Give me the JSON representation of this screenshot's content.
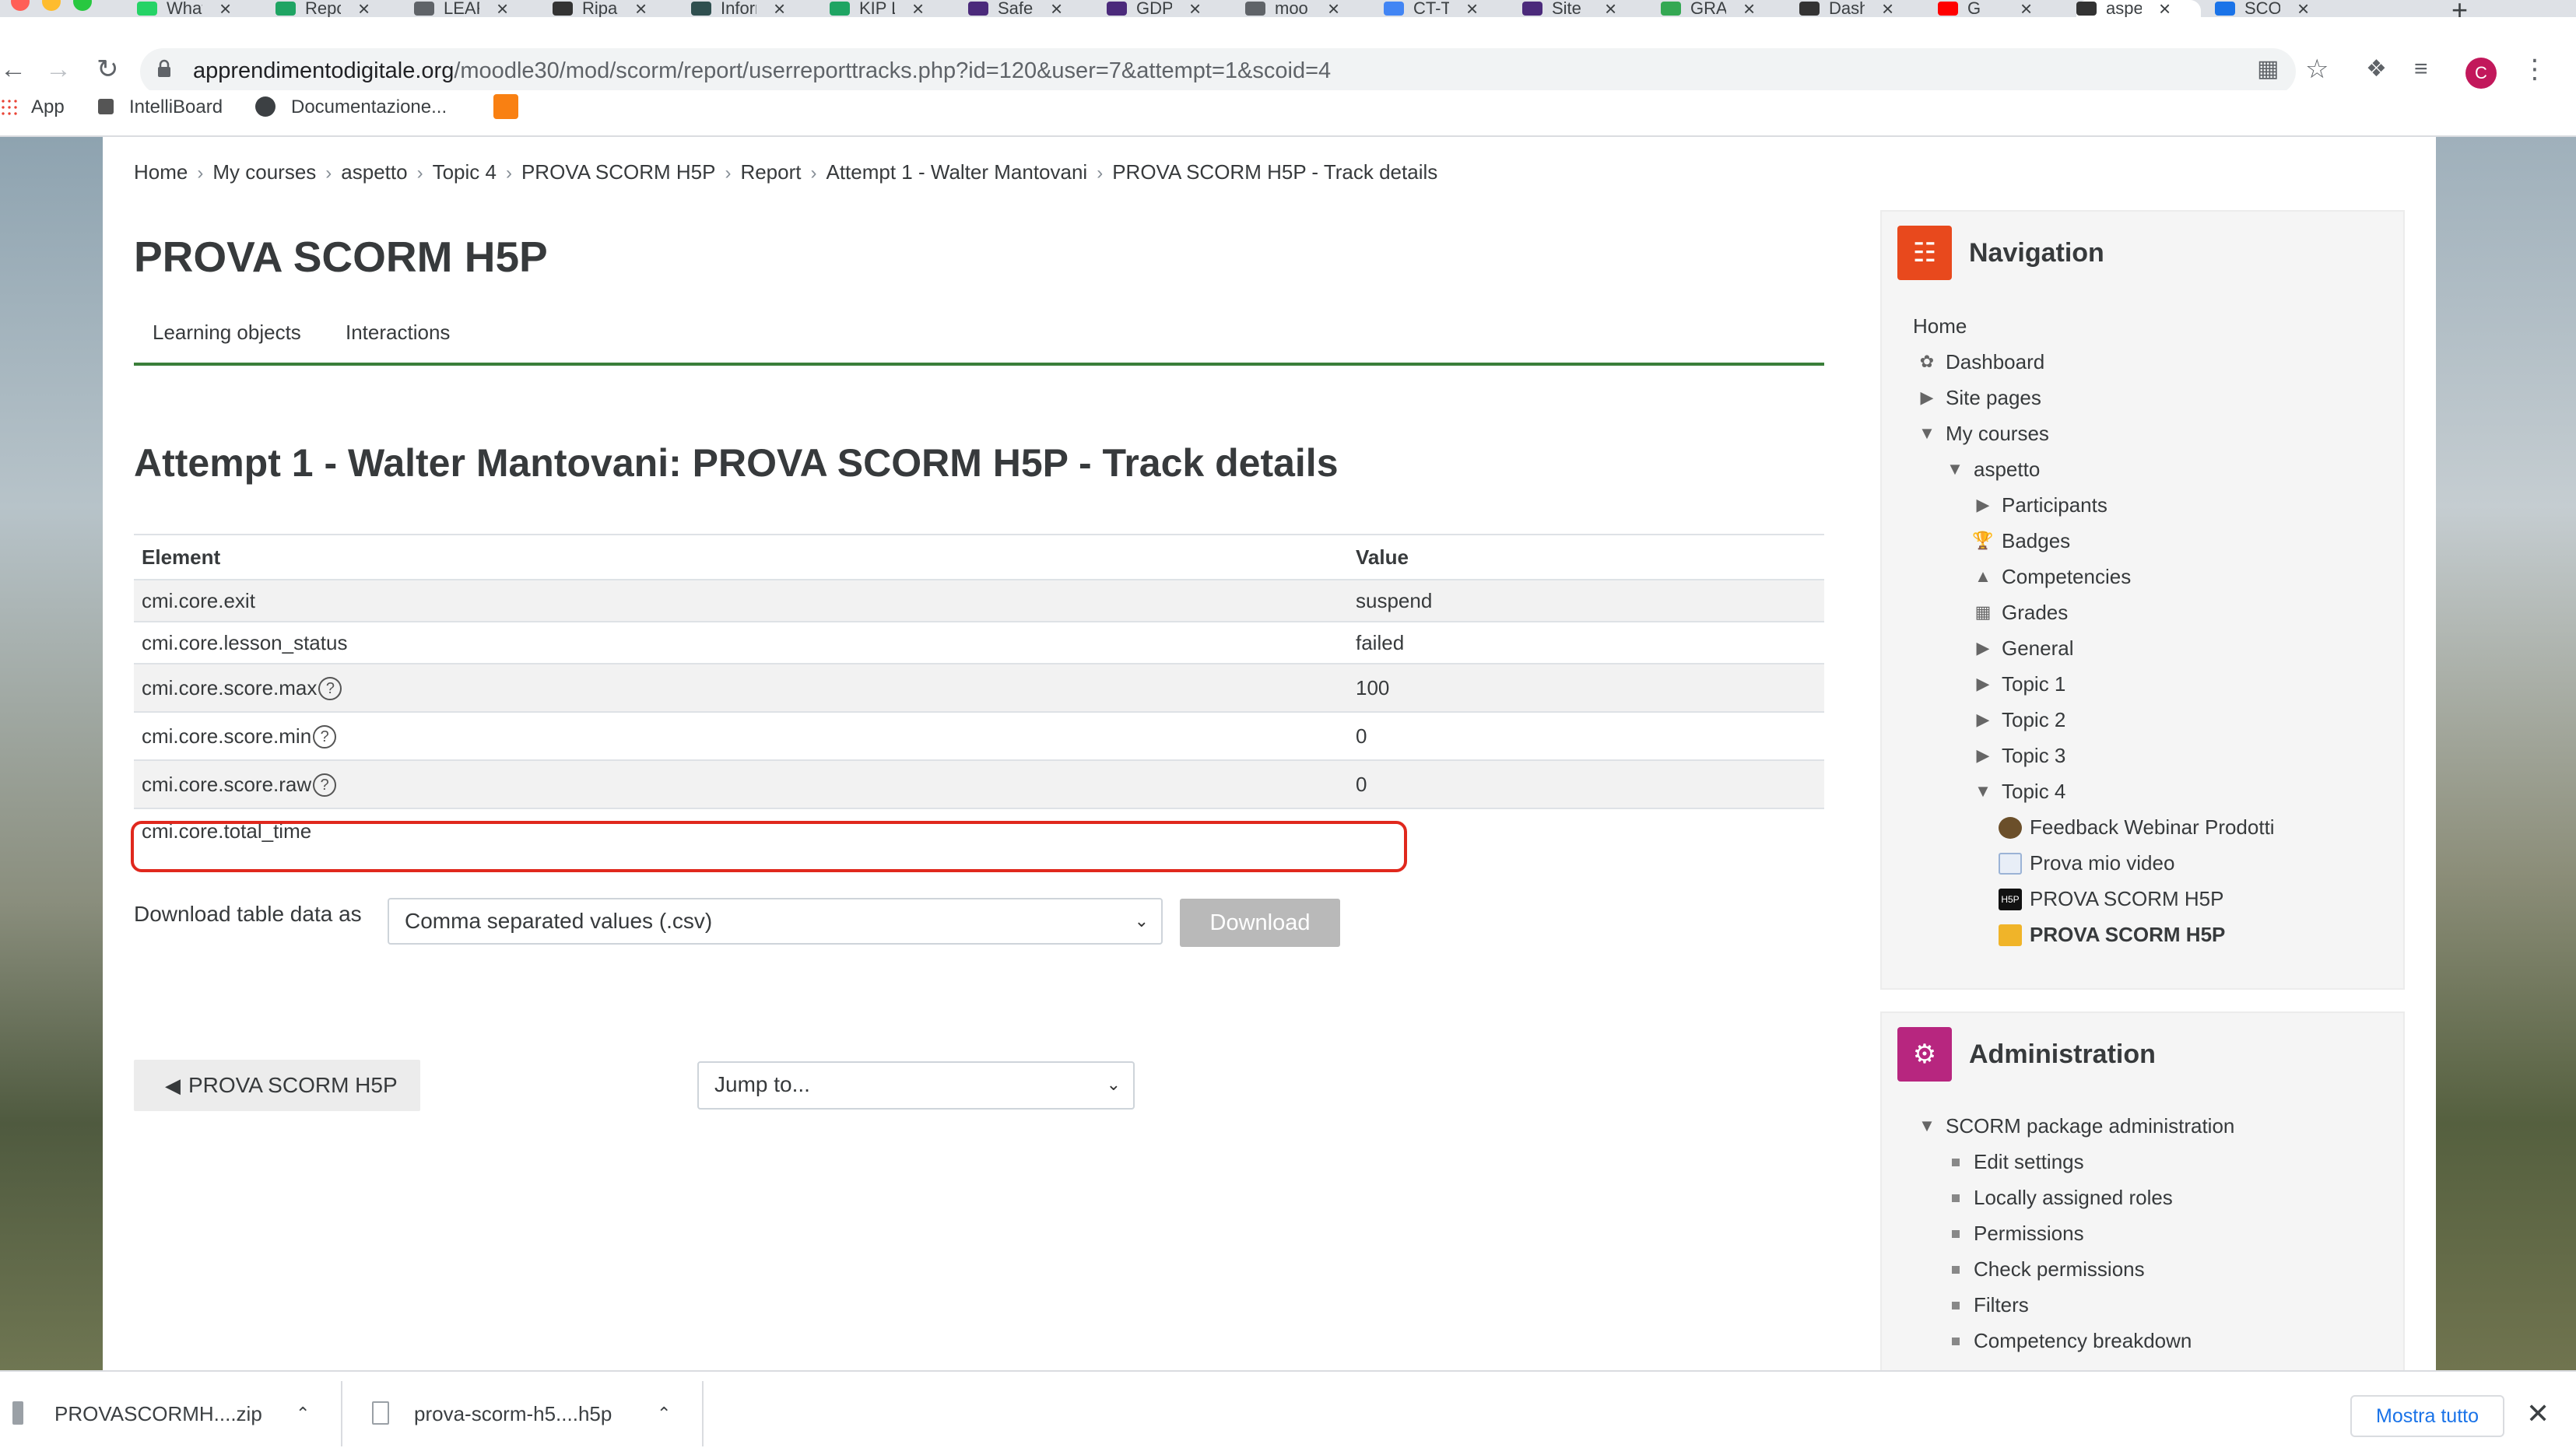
{
  "browser": {
    "tabs": [
      {
        "label": "What",
        "color": "#25d366"
      },
      {
        "label": "Repo",
        "color": "#1fa463"
      },
      {
        "label": "LEAR",
        "color": "#5f6368"
      },
      {
        "label": "Ripar",
        "color": "#333333"
      },
      {
        "label": "Inforr",
        "color": "#2f4f4f"
      },
      {
        "label": "KIP L",
        "color": "#1fa463"
      },
      {
        "label": "Safe",
        "color": "#4b2a7b"
      },
      {
        "label": "GDPI",
        "color": "#4b2a7b"
      },
      {
        "label": "moo",
        "color": "#5f6368"
      },
      {
        "label": "CT-T",
        "color": "#4285f4"
      },
      {
        "label": "Site",
        "color": "#4b2a7b"
      },
      {
        "label": "GRAI",
        "color": "#34a853"
      },
      {
        "label": "Dash",
        "color": "#333333"
      },
      {
        "label": "G",
        "color": "#ff0000"
      },
      {
        "label": "aspe",
        "color": "#333333"
      },
      {
        "label": "SCOI",
        "color": "#1a73e8"
      }
    ],
    "url_host": "apprendimentodigitale.org",
    "url_path": "/moodle30/mod/scorm/report/userreporttracks.php?id=120&user=7&attempt=1&scoid=4",
    "profile_initial": "C",
    "bookmarks": [
      "App",
      "IntelliBoard",
      "Documentazione..."
    ]
  },
  "breadcrumb": [
    "Home",
    "My courses",
    "aspetto",
    "Topic 4",
    "PROVA SCORM H5P",
    "Report",
    "Attempt 1 - Walter Mantovani",
    "PROVA SCORM H5P - Track details"
  ],
  "course_title": "PROVA SCORM H5P",
  "tabs": [
    "Learning objects",
    "Interactions"
  ],
  "attempt_heading": "Attempt 1 - Walter Mantovani: PROVA SCORM H5P - Track details",
  "table": {
    "headers": [
      "Element",
      "Value"
    ],
    "rows": [
      {
        "element": "cmi.core.exit",
        "value": "suspend",
        "help": false
      },
      {
        "element": "cmi.core.lesson_status",
        "value": "failed",
        "help": false
      },
      {
        "element": "cmi.core.score.max",
        "value": "100",
        "help": true
      },
      {
        "element": "cmi.core.score.min",
        "value": "0",
        "help": true
      },
      {
        "element": "cmi.core.score.raw",
        "value": "0",
        "help": true
      },
      {
        "element": "cmi.core.total_time",
        "value": "",
        "help": false
      }
    ]
  },
  "download": {
    "label": "Download table data as",
    "format": "Comma separated values (.csv)",
    "button": "Download"
  },
  "back_button": "PROVA SCORM H5P",
  "jump_to": "Jump to...",
  "navigation": {
    "title": "Navigation",
    "accent": "#e8491d",
    "items": [
      "Home",
      "Dashboard",
      "Site pages",
      "My courses",
      "aspetto",
      "Participants",
      "Badges",
      "Competencies",
      "Grades",
      "General",
      "Topic 1",
      "Topic 2",
      "Topic 3",
      "Topic 4",
      "Feedback Webinar Prodotti",
      "Prova mio video",
      "PROVA SCORM H5P",
      "PROVA SCORM H5P"
    ]
  },
  "administration": {
    "title": "Administration",
    "accent": "#b7267f",
    "section": "SCORM package administration",
    "items": [
      "Edit settings",
      "Locally assigned roles",
      "Permissions",
      "Check permissions",
      "Filters",
      "Competency breakdown"
    ]
  },
  "downloads_shelf": {
    "files": [
      "PROVASCORMH....zip",
      "prova-scorm-h5....h5p"
    ],
    "show_all": "Mostra tutto"
  }
}
